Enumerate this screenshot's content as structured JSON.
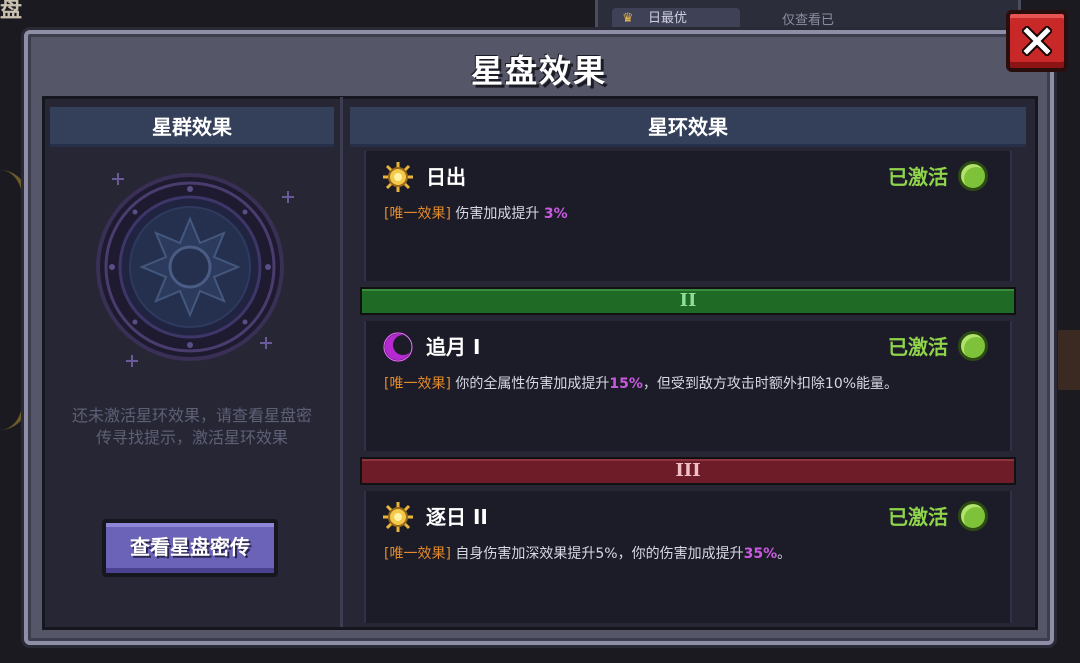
{
  "background": {
    "top_left_fragment": "盘",
    "tab_label": "日最优",
    "only_view_label": "仅查看已"
  },
  "dialog": {
    "title": "星盘效果",
    "close_icon": "close-x-icon"
  },
  "left": {
    "header": "星群效果",
    "hint_line1": "还未激活星环效果，请查看星盘密",
    "hint_line2": "传寻找提示，激活星环效果",
    "button_label": "查看星盘密传"
  },
  "right": {
    "header": "星环效果",
    "effects": [
      {
        "icon": "sun-icon",
        "name": "日出",
        "status": "已激活",
        "tag": "[唯一效果]",
        "desc_before": "伤害加成提升",
        "desc_value": "3%",
        "desc_after": ""
      },
      {
        "icon": "moon-icon",
        "name": "追月 I",
        "status": "已激活",
        "tag": "[唯一效果]",
        "desc_before": "你的全属性伤害加成提升",
        "desc_value": "15%",
        "desc_after": "，但受到敌方攻击时额外扣除10%能量。"
      },
      {
        "icon": "sun-icon",
        "name": "逐日 II",
        "status": "已激活",
        "tag": "[唯一效果]",
        "desc_before": "自身伤害加深效果提升5%，你的伤害加成提升",
        "desc_value": "35%",
        "desc_after": "。"
      }
    ],
    "tiers": [
      {
        "label": "II"
      },
      {
        "label": "III"
      }
    ]
  },
  "colors": {
    "panel": "#555668",
    "header": "#34405a",
    "active_green": "#8fd44a",
    "tag_orange": "#e08a2c",
    "value_purple": "#c95ae0",
    "tier2_green": "#1f6a24",
    "tier3_red": "#6e1c28",
    "close_red": "#c82828",
    "button_purple": "#6b63b8"
  }
}
